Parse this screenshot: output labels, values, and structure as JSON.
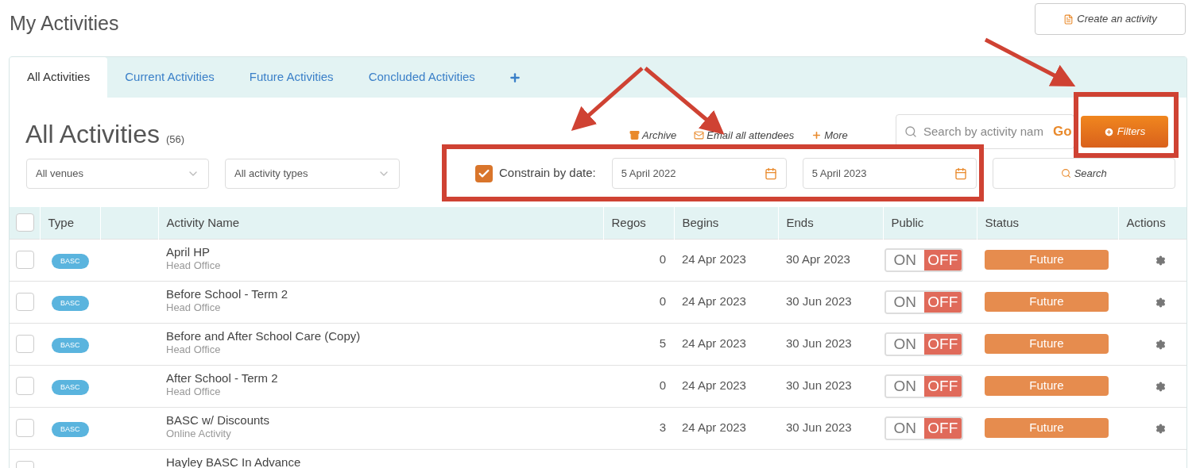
{
  "page_title": "My Activities",
  "create_button": "Create an activity",
  "tabs": [
    {
      "label": "All Activities",
      "selected": true
    },
    {
      "label": "Current Activities",
      "selected": false
    },
    {
      "label": "Future Activities",
      "selected": false
    },
    {
      "label": "Concluded Activities",
      "selected": false
    }
  ],
  "heading": "All Activities",
  "count": "(56)",
  "toolbar": [
    {
      "kind": "archive",
      "label": "Archive"
    },
    {
      "kind": "email",
      "label": "Email all attendees"
    },
    {
      "kind": "more",
      "label": "More"
    }
  ],
  "search": {
    "placeholder": "Search by activity nam",
    "go": "Go"
  },
  "filters_button": "Filters",
  "venue_select": "All venues",
  "type_select": "All activity types",
  "constrain": {
    "label": "Constrain by date:",
    "checked": true
  },
  "date_from": "5 April 2022",
  "date_to": "5 April 2023",
  "search_button": "Search",
  "select_all": {
    "checked": false
  },
  "columns": [
    "Type",
    "Activity Name",
    "Regos",
    "Begins",
    "Ends",
    "Public",
    "Status",
    "Actions"
  ],
  "rows": [
    {
      "selected": false,
      "type": "BASC",
      "name": "April HP",
      "venue": "Head Office",
      "regos": "0",
      "begins": "24 Apr 2023",
      "ends": "30 Apr 2023",
      "public": {
        "on_label": "ON",
        "off_label": "OFF",
        "on": false
      },
      "status": "Future"
    },
    {
      "selected": false,
      "type": "BASC",
      "name": "Before School - Term 2",
      "venue": "Head Office",
      "regos": "0",
      "begins": "24 Apr 2023",
      "ends": "30 Jun 2023",
      "public": {
        "on_label": "ON",
        "off_label": "OFF",
        "on": false
      },
      "status": "Future"
    },
    {
      "selected": false,
      "type": "BASC",
      "name": "Before and After School Care (Copy)",
      "venue": "Head Office",
      "regos": "5",
      "begins": "24 Apr 2023",
      "ends": "30 Jun 2023",
      "public": {
        "on_label": "ON",
        "off_label": "OFF",
        "on": false
      },
      "status": "Future"
    },
    {
      "selected": false,
      "type": "BASC",
      "name": "After School - Term 2",
      "venue": "Head Office",
      "regos": "0",
      "begins": "24 Apr 2023",
      "ends": "30 Jun 2023",
      "public": {
        "on_label": "ON",
        "off_label": "OFF",
        "on": false
      },
      "status": "Future"
    },
    {
      "selected": false,
      "type": "BASC",
      "name": "BASC w/ Discounts",
      "venue": "Online Activity",
      "regos": "3",
      "begins": "24 Apr 2023",
      "ends": "30 Jun 2023",
      "public": {
        "on_label": "ON",
        "off_label": "OFF",
        "on": false
      },
      "status": "Future"
    },
    {
      "selected": false,
      "name": "Hayley BASC In Advance"
    }
  ]
}
